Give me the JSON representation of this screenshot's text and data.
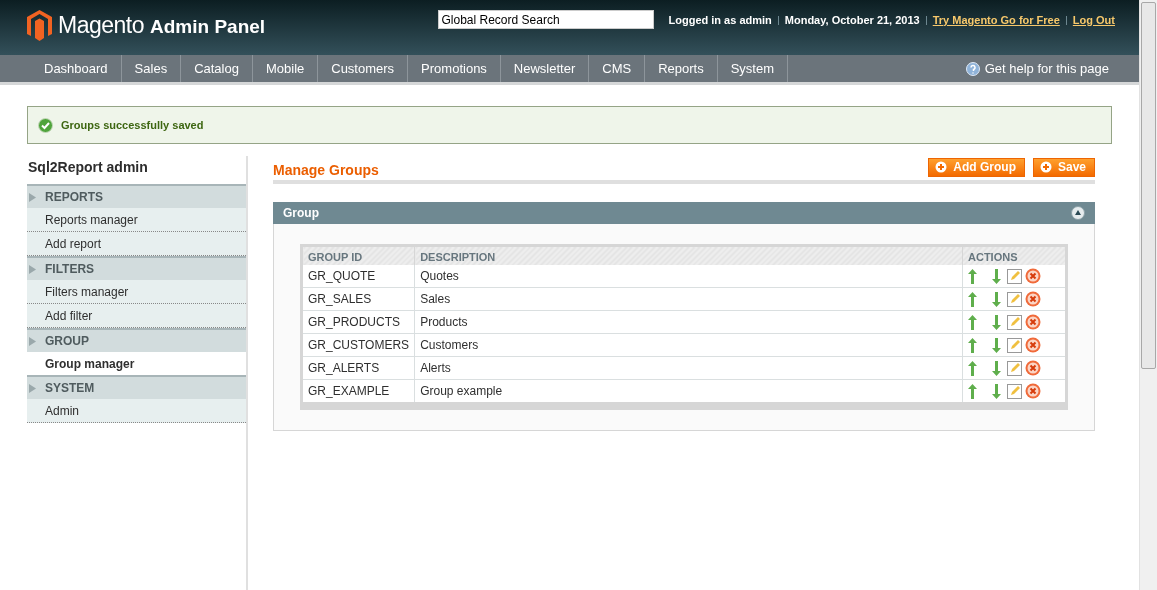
{
  "header": {
    "logo": "Magento",
    "logo_suffix": "Admin Panel",
    "search": {
      "placeholder": "Global Record Search"
    },
    "user": "Logged in as admin",
    "date": "Monday, October 21, 2013",
    "links": [
      "Try Magento Go for Free",
      "Log Out"
    ]
  },
  "nav": {
    "items": [
      "Dashboard",
      "Sales",
      "Catalog",
      "Mobile",
      "Customers",
      "Promotions",
      "Newsletter",
      "CMS",
      "Reports",
      "System"
    ],
    "help": "Get help for this page"
  },
  "message": "Groups successfully saved",
  "sidebar": {
    "title": "Sql2Report admin",
    "sections": [
      {
        "title": "REPORTS",
        "items": [
          {
            "label": "Reports manager",
            "selected": false
          },
          {
            "label": "Add report",
            "selected": false
          }
        ]
      },
      {
        "title": "FILTERS",
        "items": [
          {
            "label": "Filters manager",
            "selected": false
          },
          {
            "label": "Add filter",
            "selected": false
          }
        ]
      },
      {
        "title": "GROUP",
        "items": [
          {
            "label": "Group manager",
            "selected": true
          }
        ]
      },
      {
        "title": "SYSTEM",
        "items": [
          {
            "label": "Admin",
            "selected": false
          }
        ]
      }
    ]
  },
  "main": {
    "title": "Manage Groups",
    "buttons": [
      "Add Group",
      "Save"
    ],
    "panel": {
      "title": "Group",
      "expanded": true
    },
    "table": {
      "columns": [
        "GROUP ID",
        "DESCRIPTION",
        "ACTIONS"
      ],
      "rows": [
        {
          "id": "GR_QUOTE",
          "description": "Quotes"
        },
        {
          "id": "GR_SALES",
          "description": "Sales"
        },
        {
          "id": "GR_PRODUCTS",
          "description": "Products"
        },
        {
          "id": "GR_CUSTOMERS",
          "description": "Customers"
        },
        {
          "id": "GR_ALERTS",
          "description": "Alerts"
        },
        {
          "id": "GR_EXAMPLE",
          "description": "Group example"
        }
      ]
    }
  }
}
